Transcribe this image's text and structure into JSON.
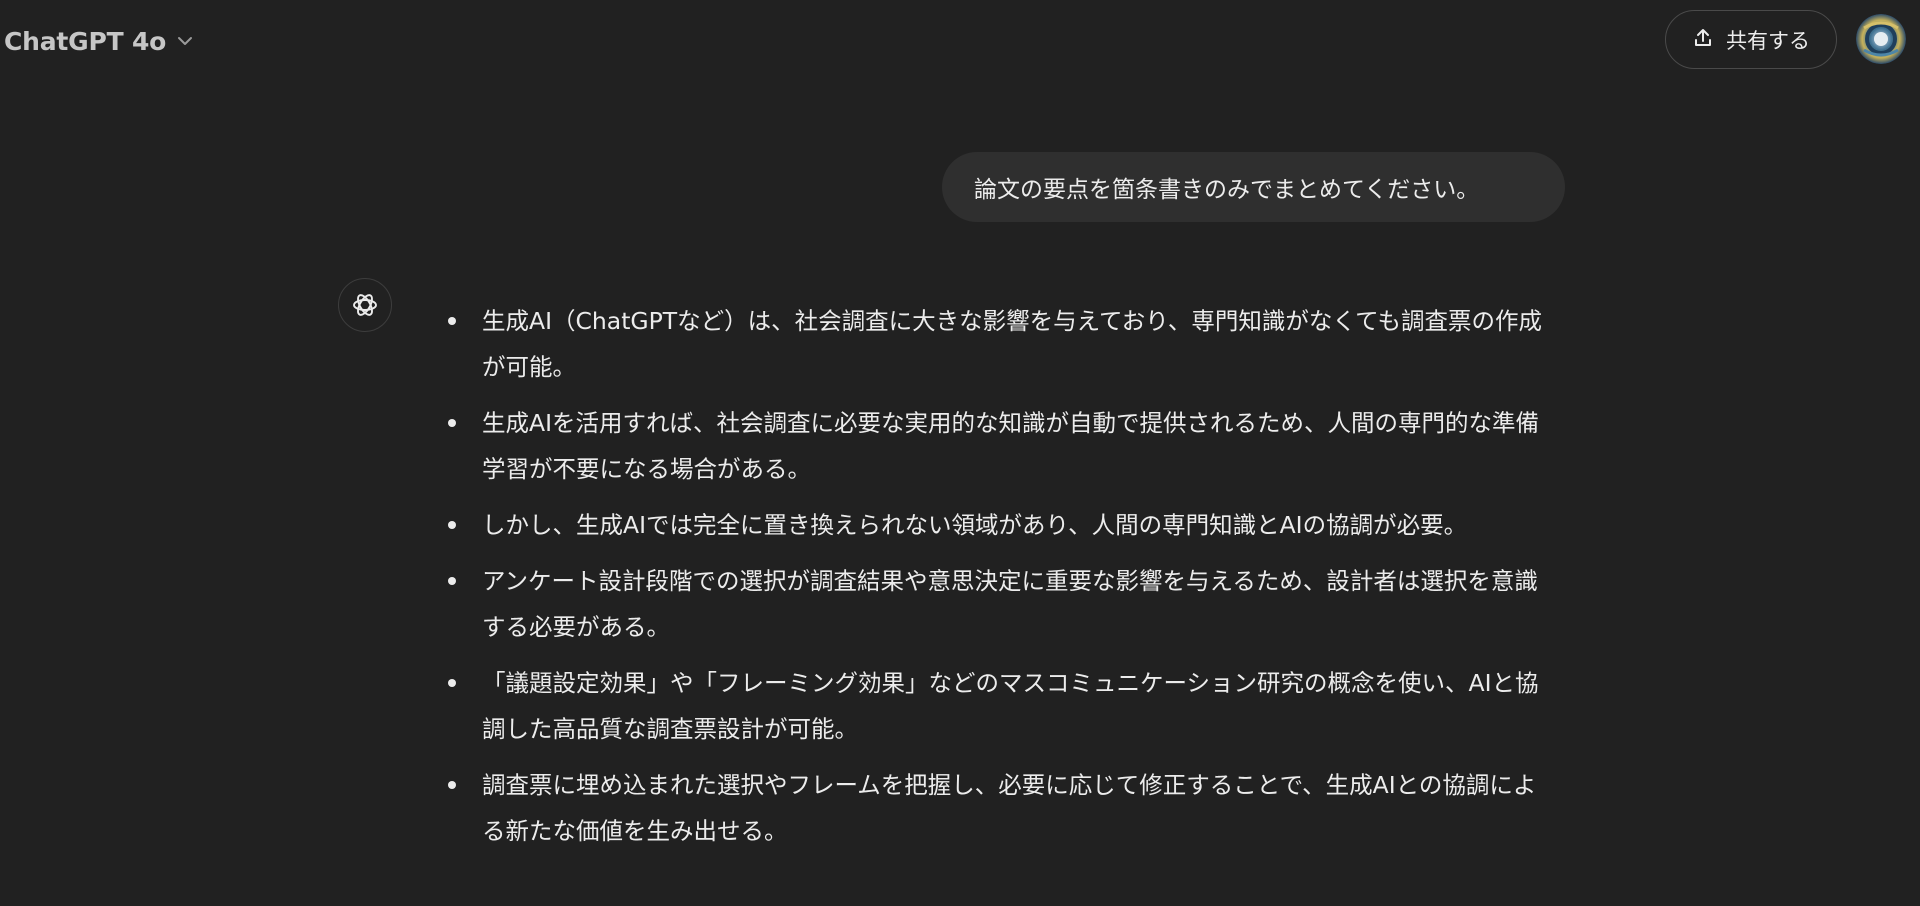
{
  "header": {
    "model_name": "ChatGPT 4o",
    "share_label": "共有する"
  },
  "conversation": {
    "user_message": "論文の要点を箇条書きのみでまとめてください。",
    "assistant_bullets": [
      "生成AI（ChatGPTなど）は、社会調査に大きな影響を与えており、専門知識がなくても調査票の作成が可能。",
      "生成AIを活用すれば、社会調査に必要な実用的な知識が自動で提供されるため、人間の専門的な準備学習が不要になる場合がある。",
      "しかし、生成AIでは完全に置き換えられない領域があり、人間の専門知識とAIの協調が必要。",
      "アンケート設計段階での選択が調査結果や意思決定に重要な影響を与えるため、設計者は選択を意識する必要がある。",
      "「議題設定効果」や「フレーミング効果」などのマスコミュニケーション研究の概念を使い、AIと協調した高品質な調査票設計が可能。",
      "調査票に埋め込まれた選択やフレームを把握し、必要に応じて修正することで、生成AIとの協調による新たな価値を生み出せる。"
    ]
  },
  "icons": {
    "model_dropdown": "chevron-down-icon",
    "share": "share-upload-icon",
    "assistant": "openai-logo-icon",
    "avatar": "user-avatar"
  },
  "colors": {
    "background": "#212121",
    "user_bubble": "#2f2f2f",
    "text": "#ececec"
  }
}
